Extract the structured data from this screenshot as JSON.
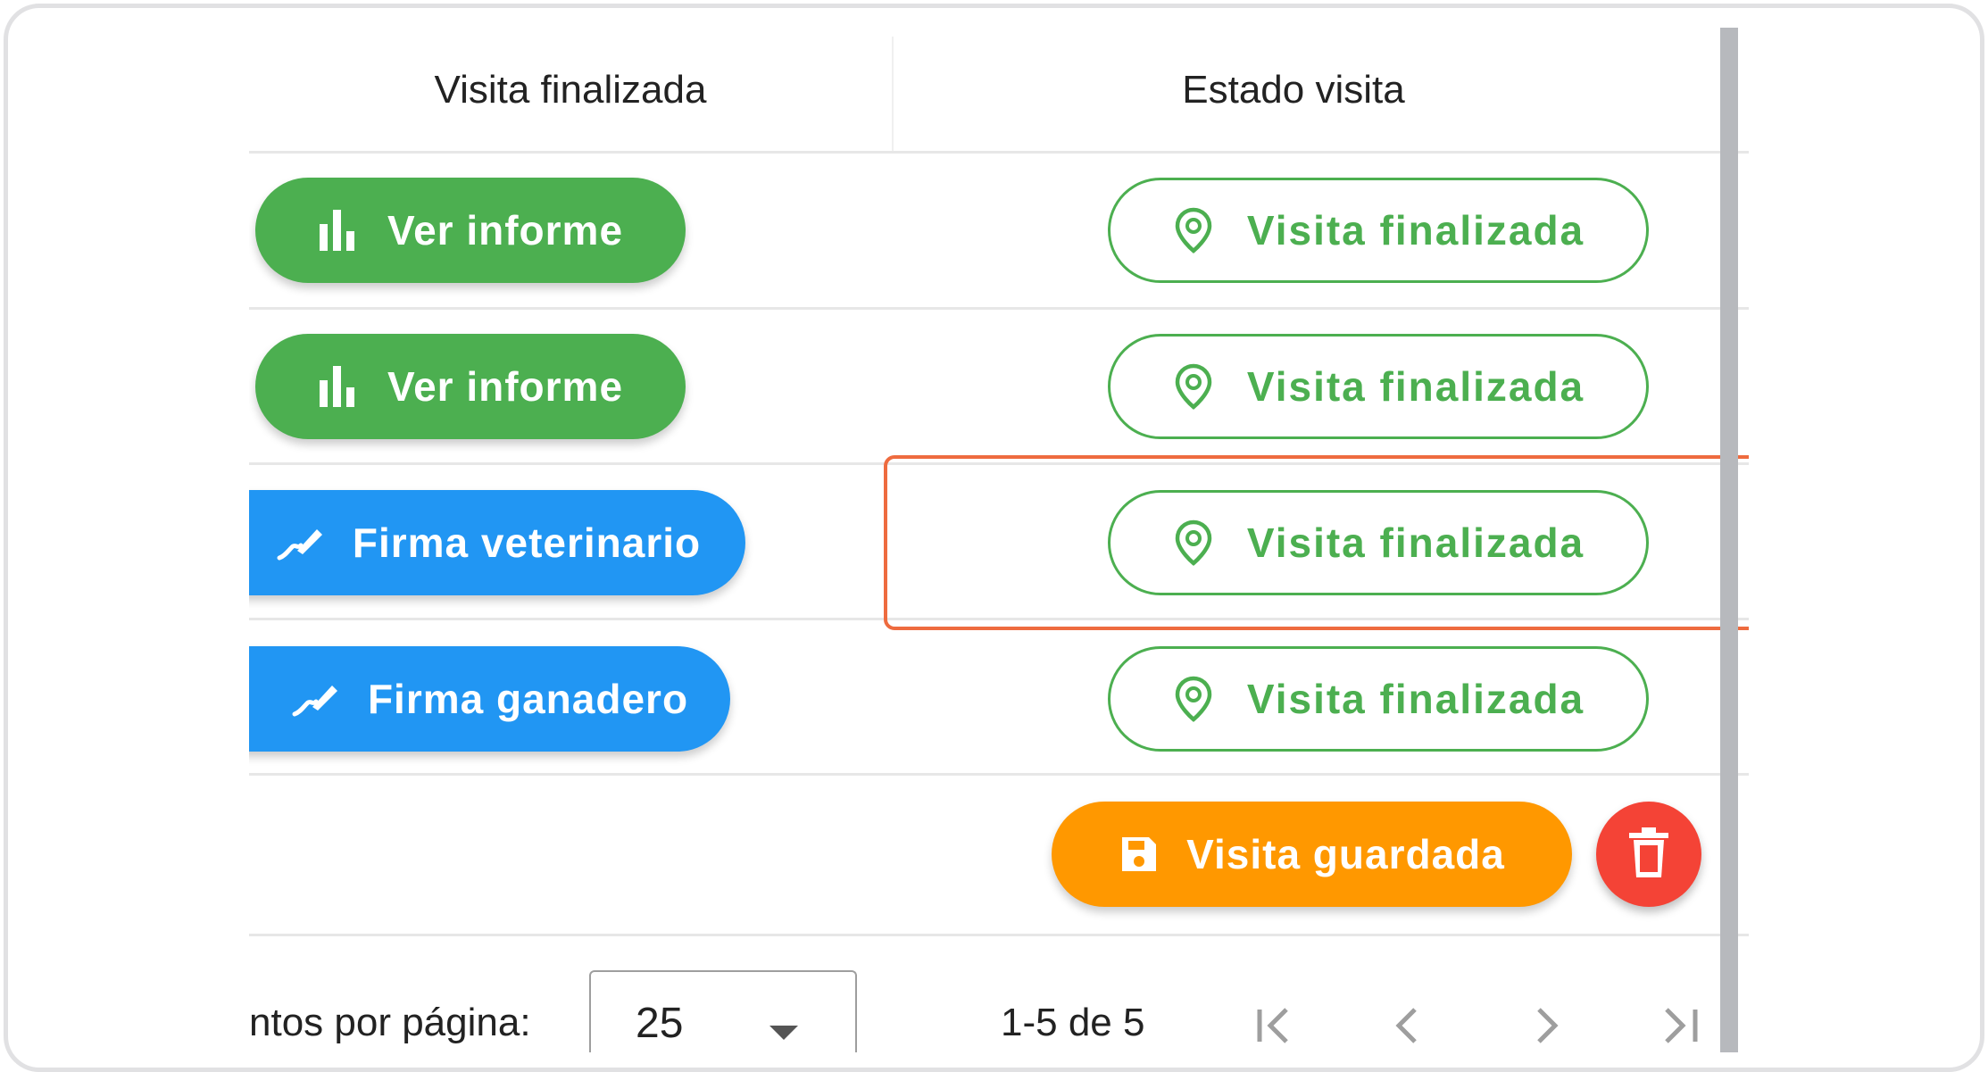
{
  "table": {
    "headers": [
      "Visita finalizada",
      "Estado visita"
    ],
    "rows": [
      {
        "action": {
          "label": "Ver informe",
          "icon": "bar-chart-icon",
          "color": "#4caf50"
        },
        "status": {
          "label": "Visita finalizada",
          "icon": "map-marker-icon",
          "color": "#4caf50"
        }
      },
      {
        "action": {
          "label": "Ver informe",
          "icon": "bar-chart-icon",
          "color": "#4caf50"
        },
        "status": {
          "label": "Visita finalizada",
          "icon": "map-marker-icon",
          "color": "#4caf50"
        }
      },
      {
        "action": {
          "label": "Firma veterinario",
          "icon": "signature-icon",
          "color": "#2196f3"
        },
        "status": {
          "label": "Visita finalizada",
          "icon": "map-marker-icon",
          "color": "#4caf50"
        }
      },
      {
        "action": {
          "label": "Firma ganadero",
          "icon": "signature-icon",
          "color": "#2196f3"
        },
        "status": {
          "label": "Visita finalizada",
          "icon": "map-marker-icon",
          "color": "#4caf50"
        }
      },
      {
        "status": {
          "label": "Visita guardada",
          "icon": "save-icon",
          "color": "#ff9800"
        },
        "delete": {
          "icon": "trash-icon",
          "color": "#f44336"
        }
      }
    ]
  },
  "pagination": {
    "rows_per_page_label": "ntos por página:",
    "rows_per_page_value": "25",
    "range": "1-5 de 5"
  },
  "highlight_color": "#ee6b3f"
}
